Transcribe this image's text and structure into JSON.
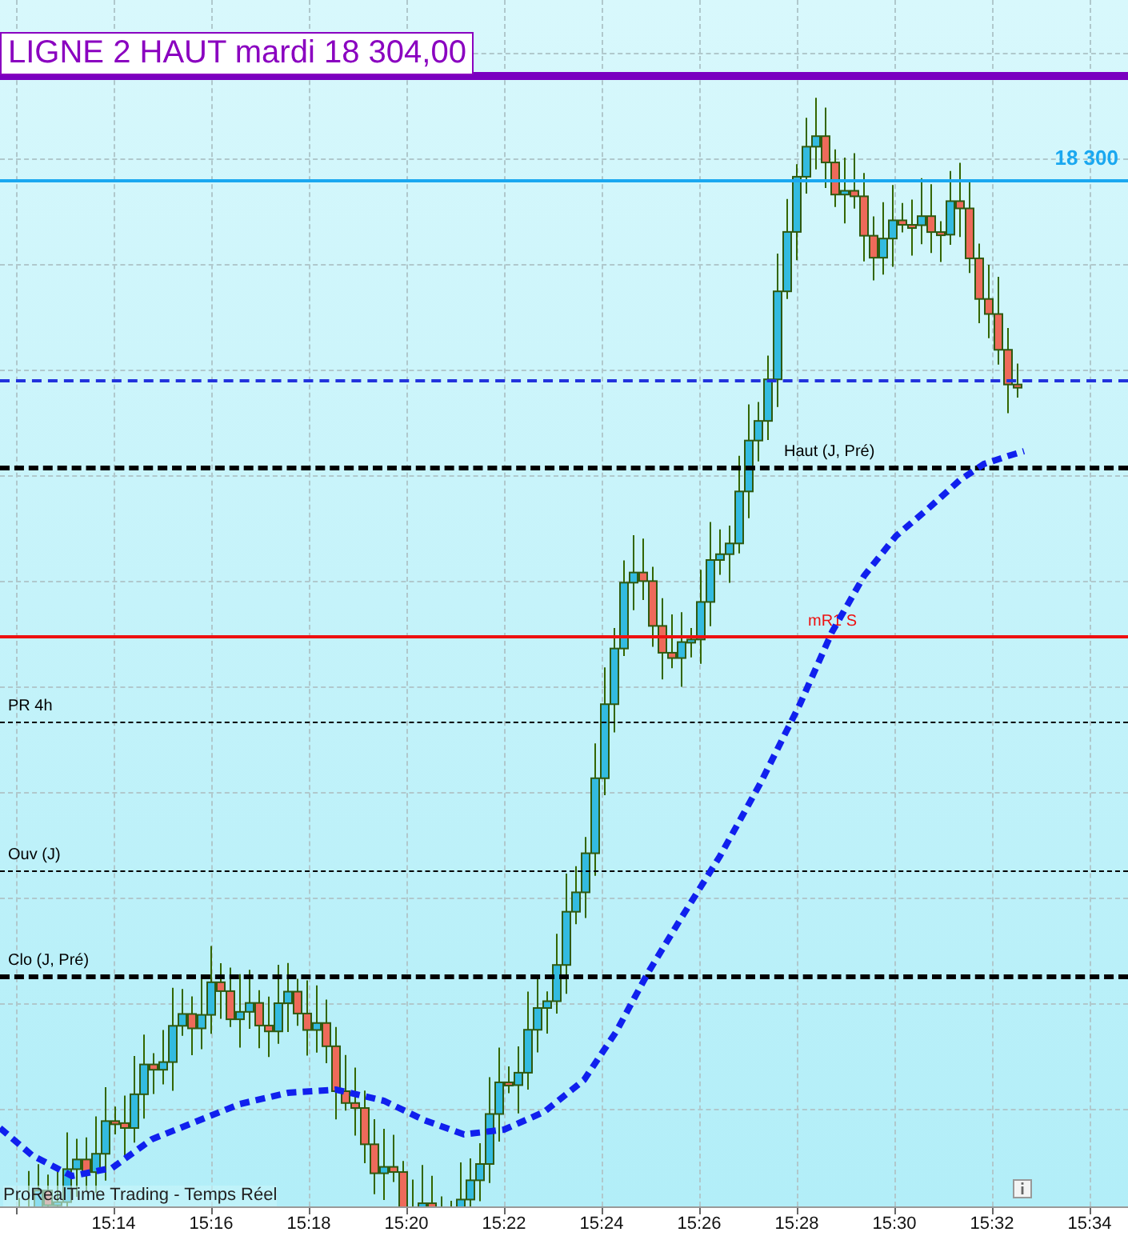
{
  "title_box": {
    "text": "LIGNE 2 HAUT mardi 18 304,00"
  },
  "levels": [
    {
      "kind": "thick",
      "color": "#7a00c0"
    },
    {
      "kind": "solid",
      "color": "#1aa8f0",
      "label": "18 300"
    },
    {
      "kind": "long-dash",
      "color": "#2233dd"
    },
    {
      "kind": "thick-dash",
      "color": "#000000",
      "label": "Haut (J, Pré)"
    },
    {
      "kind": "solid",
      "color": "#ee1111",
      "label": "mR1 S"
    },
    {
      "kind": "thin-dash",
      "color": "#000000",
      "label": "PR 4h"
    },
    {
      "kind": "thin-dash",
      "color": "#000000",
      "label": "Ouv (J)"
    },
    {
      "kind": "thick-dash",
      "color": "#000000",
      "label": "Clo (J, Pré)"
    }
  ],
  "footer": {
    "text": "ProRealTime Trading - Temps Réel"
  },
  "x_axis": {
    "ticks": [
      "15:14",
      "15:16",
      "15:18",
      "15:20",
      "15:22",
      "15:24",
      "15:26",
      "15:28",
      "15:30",
      "15:32",
      "15:34"
    ]
  }
}
